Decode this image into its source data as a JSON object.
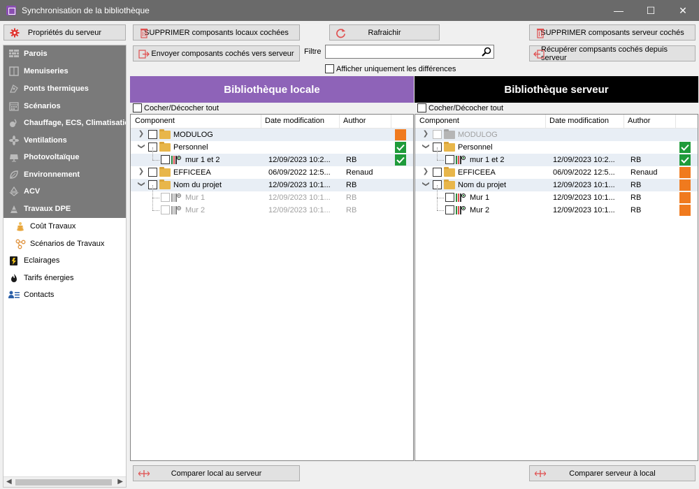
{
  "window": {
    "title": "Synchronisation de la bibliothèque",
    "controls": [
      "—",
      "☐",
      "✕"
    ]
  },
  "toolbar": {
    "server_props": "Propriétés du serveur",
    "delete_local": "SUPPRIMER composants locaux cochées",
    "refresh": "Rafraichir",
    "delete_server": "SUPPRIMER composants serveur cochés",
    "send_to_server": "Envoyer composants cochés vers serveur",
    "filter_label": "Filtre",
    "filter_value": "",
    "only_diff": "Afficher uniquement les différences",
    "retrieve_from_server": "Récupérer compsants cochés depuis serveur"
  },
  "sidebar": {
    "items": [
      {
        "label": "Parois",
        "icon": "wall-icon",
        "dark": true
      },
      {
        "label": "Menuiseries",
        "icon": "window-icon",
        "dark": true
      },
      {
        "label": "Ponts thermiques",
        "icon": "thermal-bridge-icon",
        "dark": true
      },
      {
        "label": "Scénarios",
        "icon": "calendar-icon",
        "dark": true
      },
      {
        "label": "Chauffage, ECS, Climatisation",
        "icon": "heating-icon",
        "dark": true
      },
      {
        "label": "Ventilations",
        "icon": "fan-icon",
        "dark": true
      },
      {
        "label": "Photovoltaïque",
        "icon": "solar-panel-icon",
        "dark": true
      },
      {
        "label": "Environnement",
        "icon": "leaf-icon",
        "dark": true
      },
      {
        "label": "ACV",
        "icon": "recycle-icon",
        "dark": true
      },
      {
        "label": "Travaux DPE",
        "icon": "construction-icon",
        "dark": true
      },
      {
        "label": "Coût Travaux",
        "icon": "coins-icon",
        "dark": false,
        "sub": true
      },
      {
        "label": "Scénarios de Travaux",
        "icon": "scenario-nodes-icon",
        "dark": false,
        "sub": true
      },
      {
        "label": "Eclairages",
        "icon": "lighting-icon",
        "dark": false
      },
      {
        "label": "Tarifs énergies",
        "icon": "flame-icon",
        "dark": false
      },
      {
        "label": "Contacts",
        "icon": "contacts-icon",
        "dark": false
      }
    ]
  },
  "local": {
    "header": "Bibliothèque locale",
    "check_all": "Cocher/Décocher tout",
    "columns": [
      "Component",
      "Date modification",
      "Author"
    ],
    "rows": [
      {
        "name": "MODULOG",
        "date": "",
        "author": "",
        "status": "orange"
      },
      {
        "name": "Personnel",
        "date": "",
        "author": "",
        "status": "green"
      },
      {
        "name": "mur 1 et 2",
        "date": "12/09/2023 10:2...",
        "author": "RB",
        "status": "green"
      },
      {
        "name": "EFFICEEA",
        "date": "06/09/2022 12:5...",
        "author": "Renaud",
        "status": ""
      },
      {
        "name": "Nom du projet",
        "date": "12/09/2023 10:1...",
        "author": "RB",
        "status": ""
      },
      {
        "name": "Mur 1",
        "date": "12/09/2023 10:1...",
        "author": "RB",
        "status": ""
      },
      {
        "name": "Mur 2",
        "date": "12/09/2023 10:1...",
        "author": "RB",
        "status": ""
      }
    ]
  },
  "server": {
    "header": "Bibliothèque serveur",
    "check_all": "Cocher/Décocher tout",
    "columns": [
      "Component",
      "Date modification",
      "Author"
    ],
    "rows": [
      {
        "name": "MODULOG",
        "date": "",
        "author": "",
        "status": ""
      },
      {
        "name": "Personnel",
        "date": "",
        "author": "",
        "status": "green"
      },
      {
        "name": "mur 1 et 2",
        "date": "12/09/2023 10:2...",
        "author": "RB",
        "status": "green"
      },
      {
        "name": "EFFICEEA",
        "date": "06/09/2022 12:5...",
        "author": "Renaud",
        "status": "orange"
      },
      {
        "name": "Nom du projet",
        "date": "12/09/2023 10:1...",
        "author": "RB",
        "status": "orange"
      },
      {
        "name": "Mur 1",
        "date": "12/09/2023 10:1...",
        "author": "RB",
        "status": "orange"
      },
      {
        "name": "Mur 2",
        "date": "12/09/2023 10:1...",
        "author": "RB",
        "status": "orange"
      }
    ]
  },
  "footer": {
    "compare_local": "Comparer local au serveur",
    "compare_server": "Comparer serveur à local"
  },
  "colors": {
    "accent_local": "#8e63b8",
    "accent_server": "#000000",
    "status_orange": "#f07a1e",
    "status_green": "#1f9b3a"
  }
}
